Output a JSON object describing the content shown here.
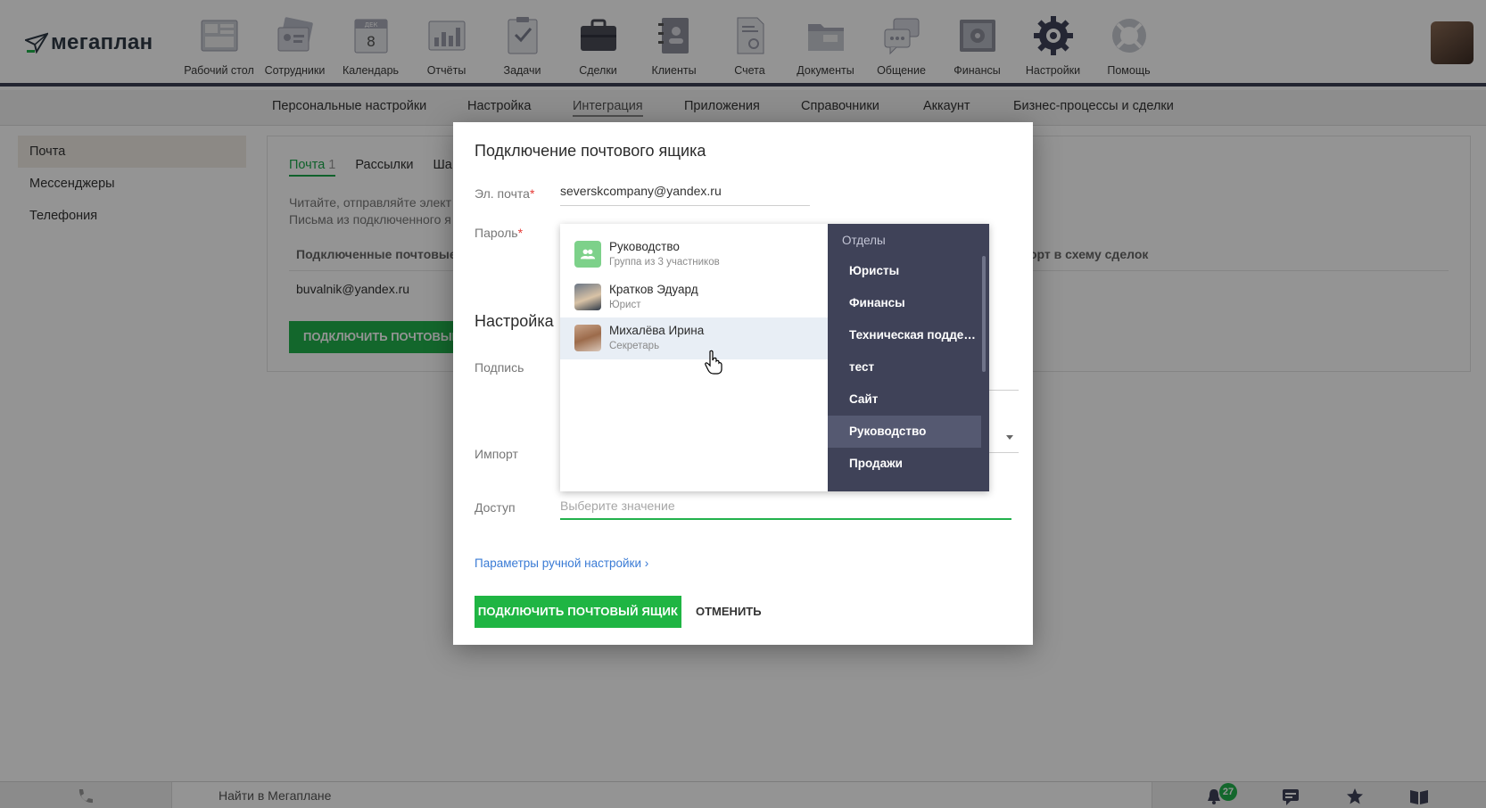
{
  "app": {
    "logo_text": "мегаплан"
  },
  "nav": [
    {
      "label": "Рабочий стол",
      "icon": "desktop-icon"
    },
    {
      "label": "Сотрудники",
      "icon": "employees-icon"
    },
    {
      "label": "Календарь",
      "icon": "calendar-icon",
      "calendar_month": "ДЕК",
      "calendar_day": "8"
    },
    {
      "label": "Отчёты",
      "icon": "reports-icon"
    },
    {
      "label": "Задачи",
      "icon": "tasks-icon"
    },
    {
      "label": "Сделки",
      "icon": "deals-icon"
    },
    {
      "label": "Клиенты",
      "icon": "clients-icon"
    },
    {
      "label": "Счета",
      "icon": "invoices-icon"
    },
    {
      "label": "Документы",
      "icon": "documents-icon"
    },
    {
      "label": "Общение",
      "icon": "chat-icon"
    },
    {
      "label": "Финансы",
      "icon": "finance-icon"
    },
    {
      "label": "Настройки",
      "icon": "gear-icon",
      "active": true
    },
    {
      "label": "Помощь",
      "icon": "help-icon"
    }
  ],
  "subnav": {
    "personal": "Персональные настройки",
    "setup": "Настройка",
    "integration": "Интеграция",
    "apps": "Приложения",
    "dictionaries": "Справочники",
    "account": "Аккаунт",
    "business": "Бизнес-процессы и сделки"
  },
  "sidebar": {
    "mail": "Почта",
    "messengers": "Мессенджеры",
    "telephony": "Телефония"
  },
  "content": {
    "tab_mail": "Почта",
    "tab_mail_count": "1",
    "tab_newsletters": "Рассылки",
    "tab_templates": "Ша",
    "desc_line1": "Читайте, отправляйте элект",
    "desc_line2": "Письма из подключенного я",
    "table_header": "Подключенные почтовые",
    "table_header_right": "орт в схему сделок",
    "mailbox": "buvalnik@yandex.ru",
    "connect_btn": "ПОДКЛЮЧИТЬ ПОЧТОВЫЙ Я"
  },
  "modal": {
    "title": "Подключение почтового ящика",
    "email_label": "Эл. почта",
    "email_value": "severskcompany@yandex.ru",
    "password_label": "Пароль",
    "required_mark": "*",
    "section_title": "Настройка",
    "signature_label": "Подпись",
    "import_label": "Импорт",
    "access_label": "Доступ",
    "access_placeholder": "Выберите значение",
    "manual_link": "Параметры ручной настройки",
    "manual_link_chevron": "›",
    "submit": "ПОДКЛЮЧИТЬ ПОЧТОВЫЙ ЯЩИК",
    "cancel": "ОТМЕНИТЬ"
  },
  "dropdown": {
    "options": [
      {
        "name": "Руководство",
        "sub": "Группа из 3 участников"
      },
      {
        "name": "Кратков Эдуард",
        "sub": "Юрист"
      },
      {
        "name": "Михалёва Ирина",
        "sub": "Секретарь"
      }
    ],
    "categories_header": "Отделы",
    "categories": [
      "Юристы",
      "Финансы",
      "Техническая поддержка",
      "тест",
      "Сайт",
      "Руководство",
      "Продажи"
    ]
  },
  "footer": {
    "search_placeholder": "Найти в Мегаплане",
    "notifications_count": "27"
  },
  "colors": {
    "accent_green": "#22b14c",
    "dark_nav": "#3f4258",
    "link_blue": "#3a7bd5"
  }
}
